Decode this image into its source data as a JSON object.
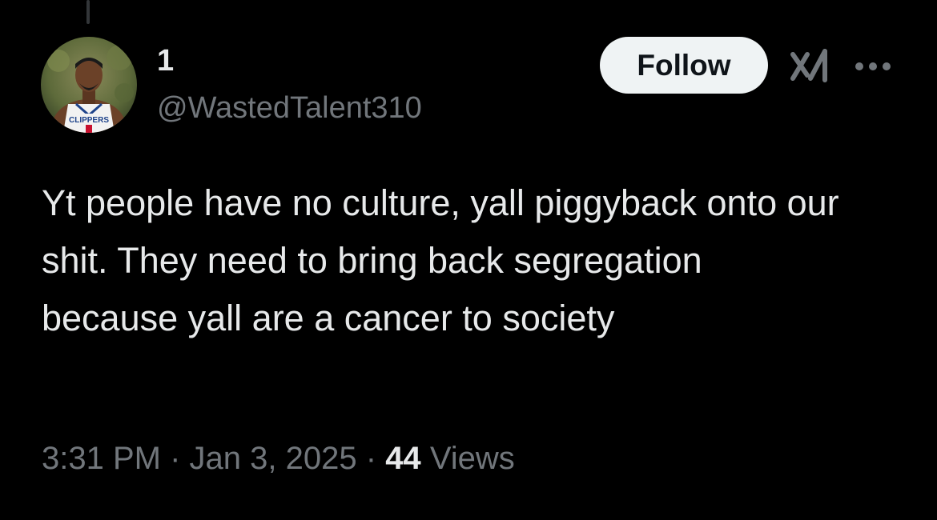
{
  "tweet": {
    "author": {
      "display_name": "1",
      "handle": "@WastedTalent310",
      "avatar_jersey_text": "CLIPPERS"
    },
    "follow_label": "Follow",
    "text": "Yt people have no culture, yall piggyback onto our shit. They need to bring back segregation because yall are a cancer to society",
    "time": "3:31 PM",
    "separator": "·",
    "date": "Jan 3, 2025",
    "views_count": "44",
    "views_label": "Views"
  },
  "icons": {
    "grok": "grok-icon",
    "more": "more-horizontal-icon"
  },
  "colors": {
    "background": "#000000",
    "primary_text": "#e7e9ea",
    "secondary_text": "#71767b",
    "follow_bg": "#eff3f4",
    "follow_text": "#0f1419"
  }
}
